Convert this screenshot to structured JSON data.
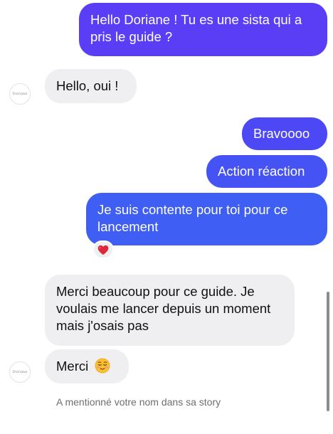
{
  "colors": {
    "outgoing_top": "#5b3df6",
    "outgoing_bottom": "#3d63f3",
    "incoming": "#efeff1",
    "reaction_heart": "#e0263a"
  },
  "contact": {
    "avatar_text": "Doriane"
  },
  "messages": [
    {
      "sender": "me",
      "text": "Hello Doriane ! Tu es une sista qui a pris le guide ?"
    },
    {
      "sender": "them",
      "text": "Hello, oui !"
    },
    {
      "sender": "me",
      "text": "Bravoooo"
    },
    {
      "sender": "me",
      "text": "Action réaction"
    },
    {
      "sender": "me",
      "text": "Je suis contente pour toi pour ce lancement",
      "reaction": "heart-emoji"
    },
    {
      "sender": "them",
      "text": "Merci beaucoup pour ce guide. Je voulais me lancer depuis un moment mais j'osais pas"
    },
    {
      "sender": "them",
      "text": "Merci",
      "emoji": "relieved-face-emoji"
    }
  ],
  "story_mention": "A mentionné votre nom dans sa story"
}
